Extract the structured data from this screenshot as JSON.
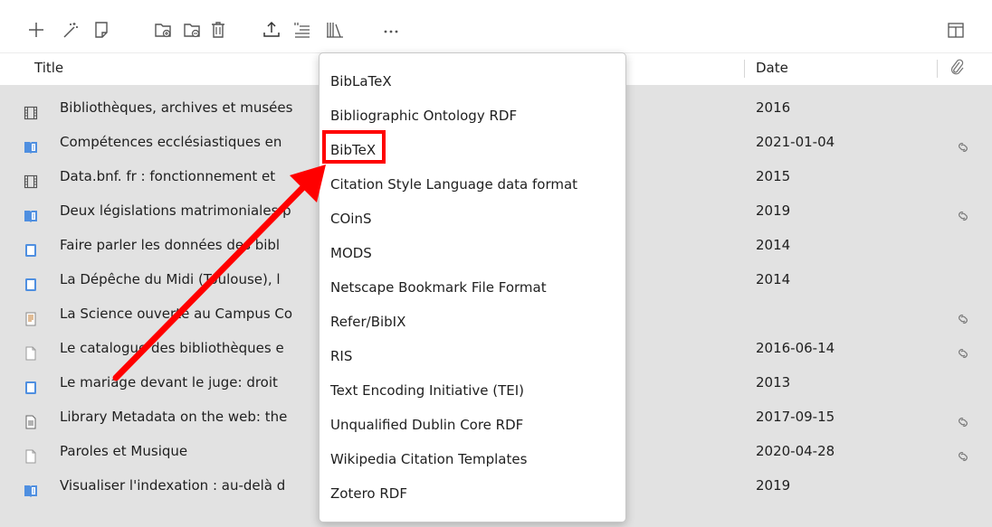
{
  "toolbar": {
    "icons": [
      "new-item-icon",
      "magic-wand-icon",
      "new-note-icon",
      "new-collection-icon",
      "remove-from-collection-icon",
      "trash-icon",
      "export-icon",
      "citation-icon",
      "library-icon",
      "more-icon",
      "column-picker-icon"
    ]
  },
  "table": {
    "headers": {
      "title": "Title",
      "date": "Date"
    },
    "rows": [
      {
        "icon": "film-icon",
        "title": "Bibliothèques, archives et musées",
        "date": "2016",
        "linked": false
      },
      {
        "icon": "book-section-icon",
        "title": "Compétences ecclésiastiques en",
        "date": "2021-01-04",
        "linked": true
      },
      {
        "icon": "film-icon",
        "title": "Data.bnf. fr : fonctionnement et",
        "date": "2015",
        "linked": false
      },
      {
        "icon": "book-section-icon",
        "title": "Deux législations matrimoniales p",
        "date": "2019",
        "linked": true
      },
      {
        "icon": "book-icon",
        "title": "Faire parler les données des bibl",
        "date": "2014",
        "linked": false
      },
      {
        "icon": "book-icon",
        "title": "La Dépêche du Midi (Toulouse), l",
        "date": "2014",
        "linked": false,
        "extra": "."
      },
      {
        "icon": "report-icon",
        "title": "La Science ouverte au Campus Co",
        "date": "",
        "linked": true
      },
      {
        "icon": "document-icon",
        "title": "Le catalogue des bibliothèques e",
        "date": "2016-06-14",
        "linked": true
      },
      {
        "icon": "book-icon",
        "title": "Le mariage devant le juge: droit",
        "date": "2013",
        "linked": false
      },
      {
        "icon": "text-document-icon",
        "title": "Library Metadata on the web: the",
        "date": "2017-09-15",
        "linked": true
      },
      {
        "icon": "document-icon",
        "title": "Paroles et Musique",
        "date": "2020-04-28",
        "linked": true
      },
      {
        "icon": "book-section-icon",
        "title": "Visualiser l'indexation : au-delà d",
        "date": "2019",
        "linked": false
      }
    ]
  },
  "export_menu": {
    "items": [
      "BibLaTeX",
      "Bibliographic Ontology RDF",
      "BibTeX",
      "Citation Style Language data format",
      "COinS",
      "MODS",
      "Netscape Bookmark File Format",
      "Refer/BibIX",
      "RIS",
      "Text Encoding Initiative (TEI)",
      "Unqualified Dublin Core RDF",
      "Wikipedia Citation Templates",
      "Zotero RDF"
    ],
    "highlighted_item": "BibTeX"
  },
  "colors": {
    "row_background": "#e2e2e2",
    "highlight": "#ff0000",
    "book_icon_blue": "#4f8fe0"
  }
}
